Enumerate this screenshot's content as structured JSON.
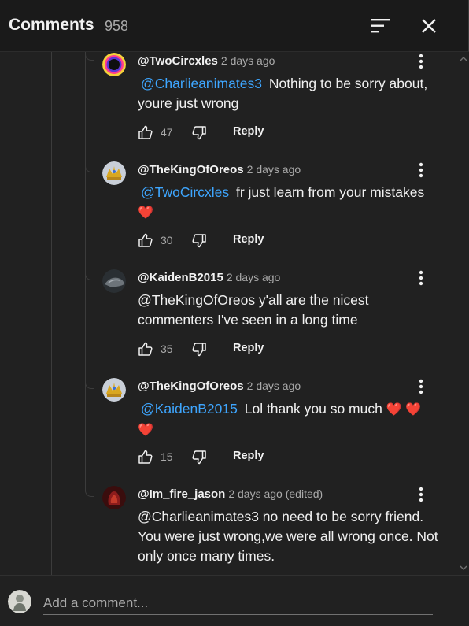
{
  "header": {
    "title": "Comments",
    "count": "958",
    "sort_icon": "sort-icon",
    "close_icon": "close-icon"
  },
  "comments": [
    {
      "handle": "@TwoCircxles",
      "time": "2 days ago",
      "body_mention": "@Charlieanimates3",
      "body_lines": [
        "Nothing to be sorry about,",
        "youre just wrong"
      ],
      "likes": "47",
      "reply_label": "Reply",
      "avatar": "circle-avatar"
    },
    {
      "handle": "@TheKingOfOreos",
      "time": "2 days ago",
      "body_mention": "@TwoCircxles",
      "body_lines": [
        "fr just learn from your mistakes"
      ],
      "hearts": "❤️",
      "likes": "30",
      "reply_label": "Reply",
      "avatar": "gold-avatar"
    },
    {
      "handle": "@KaidenB2015",
      "time": "2 days ago",
      "body_lines": [
        "@TheKingOfOreos y'all are the nicest",
        "commenters I've seen in a long time"
      ],
      "likes": "35",
      "reply_label": "Reply",
      "avatar": "dark-avatar"
    },
    {
      "handle": "@TheKingOfOreos",
      "time": "2 days ago",
      "body_mention": "@KaidenB2015",
      "body_lines": [
        "Lol thank you so much"
      ],
      "hearts": "❤️ ❤️",
      "hearts2": "❤️",
      "likes": "15",
      "reply_label": "Reply",
      "avatar": "gold-avatar"
    },
    {
      "handle": "@Im_fire_jason",
      "time": "2 days ago (edited)",
      "body_lines": [
        "@Charlieanimates3  no need to be sorry friend.",
        "You were just wrong,we were all wrong once. Not",
        "only once many times."
      ],
      "avatar": "red-avatar"
    }
  ],
  "footer": {
    "placeholder": "Add a comment..."
  },
  "colors": {
    "background": "#212121",
    "header": "#1a1a1a",
    "mention": "#3ea6ff",
    "secondary_text": "#aaaaaa"
  }
}
